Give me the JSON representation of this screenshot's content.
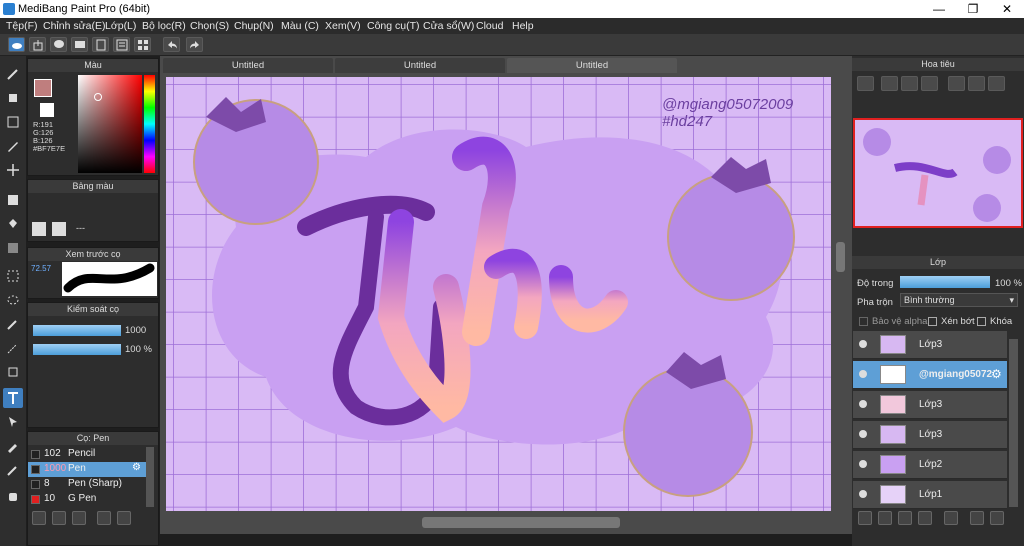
{
  "window": {
    "title": "MediBang Paint Pro (64bit)"
  },
  "menu": [
    "Tệp(F)",
    "Chỉnh sửa(E)",
    "Lớp(L)",
    "Bộ lọc(R)",
    "Chọn(S)",
    "Chụp(N)",
    "Màu (C)",
    "Xem(V)",
    "Công cụ(T)",
    "Cửa sổ(W)",
    "Cloud",
    "Help"
  ],
  "panels": {
    "color": {
      "title": "Màu",
      "r": "R:191",
      "g": "G:126",
      "b": "B:126",
      "hex": "#BF7E7E",
      "fg": "#bf7e7e"
    },
    "palette": {
      "title": "Bảng màu",
      "placeholder": "---"
    },
    "brush_preview": {
      "title": "Xem trước cọ",
      "size_label": "72.57"
    },
    "brush_control": {
      "title": "Kiểm soát cọ",
      "size": "1000",
      "opacity": "100 %"
    },
    "brushes": {
      "title": "Cọ: Pen",
      "items": [
        {
          "size": "102",
          "name": "Pencil",
          "color": "#222222"
        },
        {
          "size": "1000",
          "name": "Pen",
          "color": "#222222",
          "selected": true
        },
        {
          "size": "8",
          "name": "Pen (Sharp)",
          "color": "#222222"
        },
        {
          "size": "10",
          "name": "G Pen",
          "color": "#e02020"
        }
      ]
    }
  },
  "tabs": [
    "Untitled",
    "Untitled",
    "Untitled"
  ],
  "canvas": {
    "watermark_line1": "@mgiang05072009",
    "watermark_line2": "#hd247"
  },
  "navigator": {
    "title": "Hoa tiêu"
  },
  "layer_panel": {
    "title": "Lớp",
    "opacity_label": "Độ trong",
    "opacity_value": "100 %",
    "blend_label": "Pha trộn",
    "blend_value": "Bình thường",
    "protect_alpha": "Bảo vệ alpha",
    "clip": "Xén bớt",
    "lock": "Khóa",
    "layers": [
      {
        "name": "Lớp3"
      },
      {
        "name": "@mgiang05072",
        "selected": true
      },
      {
        "name": "Lớp3"
      },
      {
        "name": "Lớp3"
      },
      {
        "name": "Lớp2"
      },
      {
        "name": "Lớp1"
      }
    ]
  }
}
